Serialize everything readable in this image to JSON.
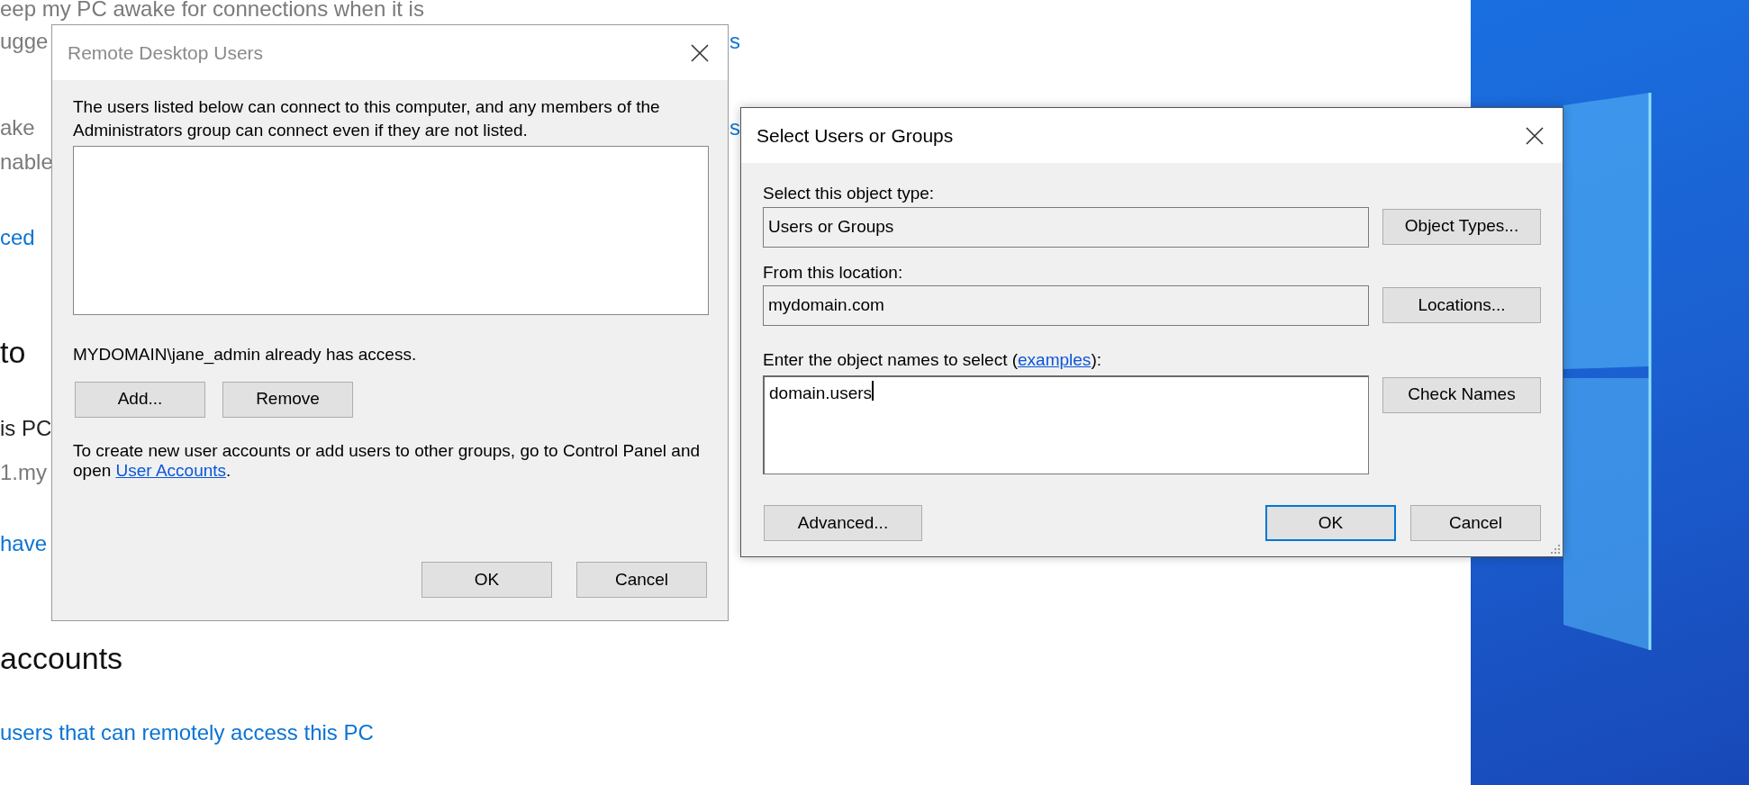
{
  "background_page": {
    "lines": [
      {
        "text": "eep my PC awake for connections when it is",
        "kind": "muted"
      },
      {
        "text": "ugge",
        "kind": "muted"
      },
      {
        "text": "ake",
        "kind": "muted"
      },
      {
        "text": "nable",
        "kind": "muted"
      },
      {
        "text": "ced",
        "kind": "link"
      },
      {
        "text": "to",
        "kind": "heading"
      },
      {
        "text": "is PC",
        "kind": "body"
      },
      {
        "text": "1.my",
        "kind": "muted"
      },
      {
        "text": "have",
        "kind": "link"
      },
      {
        "text": "accounts",
        "kind": "heading"
      },
      {
        "text": "users that can remotely access this PC",
        "kind": "link"
      }
    ],
    "right_fragments": [
      {
        "text": "s",
        "kind": "link"
      },
      {
        "text": "s",
        "kind": "link"
      }
    ]
  },
  "remote_desktop_users_dialog": {
    "title": "Remote Desktop Users",
    "active": false,
    "description": "The users listed below can connect to this computer, and any members of the Administrators group can connect even if they are not listed.",
    "access_note": "MYDOMAIN\\jane_admin already has access.",
    "buttons": [
      {
        "label": "Add..."
      },
      {
        "label": "Remove"
      }
    ],
    "help_text": {
      "before": "To create new user accounts or add users to other groups, go to Control Panel and open ",
      "link": "User Accounts",
      "after": "."
    },
    "footer_buttons": [
      {
        "label": "OK",
        "default": false
      },
      {
        "label": "Cancel",
        "default": false
      }
    ]
  },
  "select_users_dialog": {
    "title": "Select Users or Groups",
    "active": true,
    "object_type": {
      "label": "Select this object type:",
      "value": "Users or Groups",
      "button": "Object Types..."
    },
    "location": {
      "label": "From this location:",
      "value": "mydomain.com",
      "button": "Locations..."
    },
    "names": {
      "label_before": "Enter the object names to select (",
      "link": "examples",
      "label_after": "):",
      "value": "domain.users",
      "button": "Check Names"
    },
    "advanced_button": "Advanced...",
    "footer_buttons": [
      {
        "label": "OK",
        "default": true
      },
      {
        "label": "Cancel",
        "default": false
      }
    ]
  }
}
